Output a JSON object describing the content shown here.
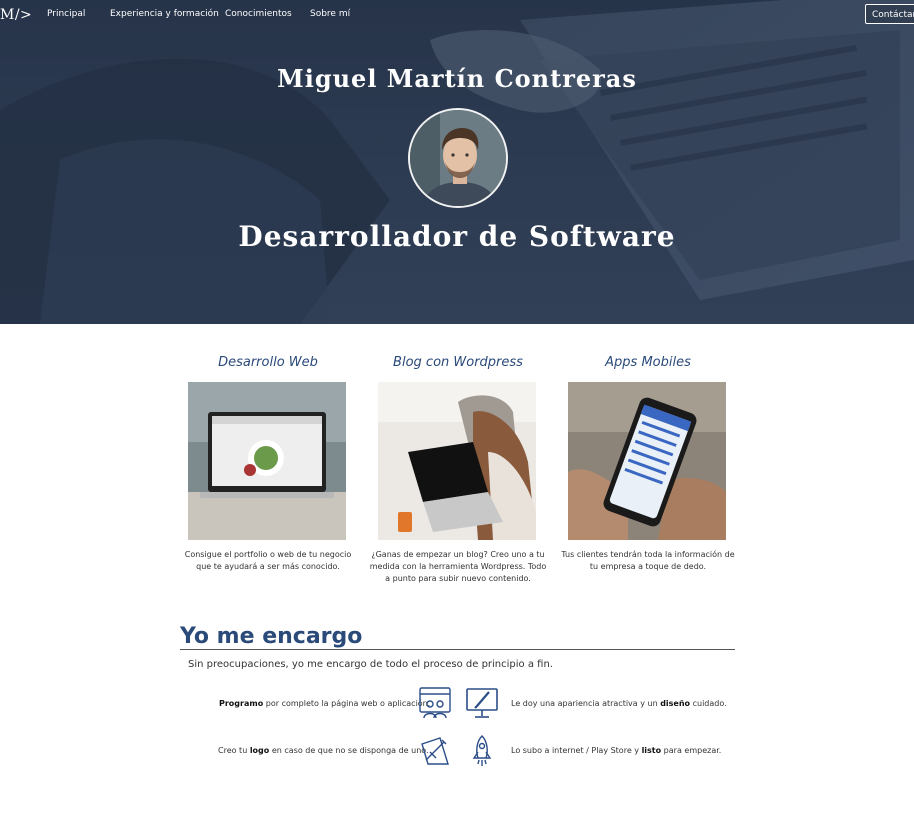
{
  "nav": {
    "logo": "M/>",
    "items": [
      "Principal",
      "Experiencia y formación",
      "Conocimientos",
      "Sobre mí"
    ],
    "contact_label": "Contáctame"
  },
  "hero": {
    "name": "Miguel Martín Contreras",
    "role": "Desarrollador de Software"
  },
  "services": [
    {
      "title": "Desarrollo Web",
      "text": "Consigue el portfolio o web de tu negocio que te ayudará a ser más conocido."
    },
    {
      "title": "Blog con Wordpress",
      "text": "¿Ganas de empezar un blog? Creo uno a tu medida con la herramienta Wordpress. Todo a punto para subir nuevo contenido."
    },
    {
      "title": "Apps Mobiles",
      "text": "Tus clientes tendrán toda la información de tu empresa a toque de dedo."
    }
  ],
  "encargo": {
    "title": "Yo me encargo",
    "subtitle": "Sin preocupaciones, yo me encargo de todo el proceso de principio a fin.",
    "f1_bold": "Programo",
    "f1_rest": " por completo la página web o aplicación.",
    "f2_pre": "Le doy una apariencia atractiva y un ",
    "f2_bold": "diseño",
    "f2_post": " cuidado.",
    "f3_pre": "Creo tu ",
    "f3_bold": "logo",
    "f3_post": " en caso de que no se disponga de uno.",
    "f4_pre": "Lo subo a internet / Play Store y ",
    "f4_bold": "listo",
    "f4_post": " para empezar."
  },
  "icons": [
    "programming-team-icon",
    "monitor-design-icon",
    "logo-design-icon",
    "rocket-icon"
  ],
  "colors": {
    "accent": "#2a4a7a",
    "hero_bg": "#34425a",
    "icon_blue": "#2c4e88"
  }
}
